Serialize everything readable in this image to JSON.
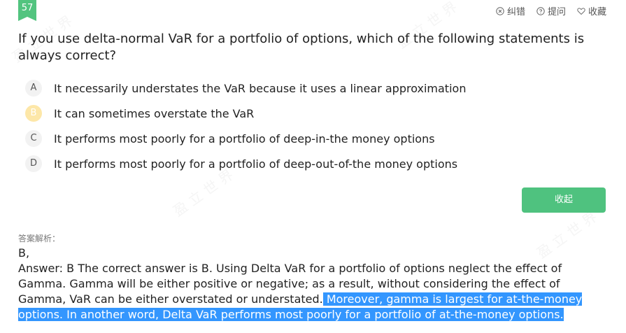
{
  "question_number": "57",
  "toolbar": {
    "report_label": "纠错",
    "ask_label": "提问",
    "favorite_label": "收藏",
    "icons": [
      "error-icon",
      "question-icon",
      "heart-icon"
    ]
  },
  "question_text": "If you use delta-normal VaR for a portfolio of options, which of the following statements is always correct?",
  "options": [
    {
      "letter": "A",
      "text": "It necessarily understates the VaR because it uses a linear approximation",
      "selected": false
    },
    {
      "letter": "B",
      "text": "It can sometimes overstate the VaR",
      "selected": true
    },
    {
      "letter": "C",
      "text": "It performs most poorly for a portfolio of deep-in-the money options",
      "selected": false
    },
    {
      "letter": "D",
      "text": "It performs most poorly for a portfolio of deep-out-of-the money options",
      "selected": false
    }
  ],
  "collapse_label": "收起",
  "analysis": {
    "label": "答案解析：",
    "answer_line": "B,",
    "text_plain": "Answer: B The correct answer is B. Using Delta VaR for a portfolio of options neglect the effect of Gamma. Gamma will be either positive or negative; as a result, without considering the effect of Gamma, VaR can be either overstated or understated.",
    "text_highlighted": " Moreover, gamma is largest for at-the-money options. In another word, Delta VaR performs most poorly for a portfolio of at-the-money options."
  },
  "colors": {
    "accent_green": "#52c47f",
    "selected_option": "#fde7a8",
    "selection_highlight": "#3396fe"
  }
}
